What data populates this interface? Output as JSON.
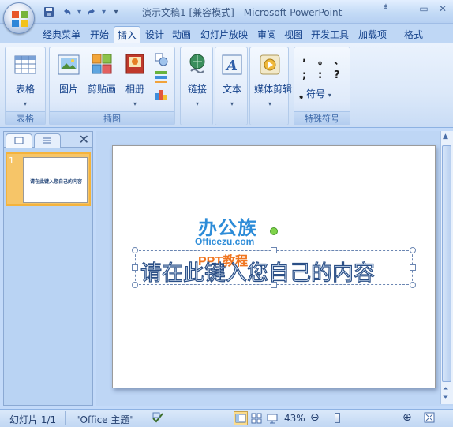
{
  "window": {
    "title": "演示文稿1 [兼容模式] - Microsoft PowerPoint"
  },
  "quick_access": {
    "items": [
      "save-icon",
      "undo-icon",
      "redo-icon",
      "customize-icon"
    ]
  },
  "tabs": [
    {
      "label": "经典菜单",
      "active": false
    },
    {
      "label": "开始",
      "active": false
    },
    {
      "label": "插入",
      "active": true
    },
    {
      "label": "设计",
      "active": false
    },
    {
      "label": "动画",
      "active": false
    },
    {
      "label": "幻灯片放映",
      "active": false
    },
    {
      "label": "审阅",
      "active": false
    },
    {
      "label": "视图",
      "active": false
    },
    {
      "label": "开发工具",
      "active": false
    },
    {
      "label": "加载项",
      "active": false
    },
    {
      "label": "格式",
      "active": false
    }
  ],
  "ribbon": {
    "table_group": {
      "label": "表格",
      "button": "表格"
    },
    "illustrations_group": {
      "label": "插图",
      "picture": "图片",
      "clipart": "剪贴画",
      "album": "相册"
    },
    "link_group": {
      "button": "链接"
    },
    "text_group": {
      "button": "文本"
    },
    "media_group": {
      "button": "媒体剪辑"
    },
    "symbols_group": {
      "label": "特殊符号",
      "button": "符号",
      "symbols": [
        ",",
        "。",
        "、",
        ";",
        ":",
        "?"
      ]
    }
  },
  "slides_panel": {
    "slide_number": "1",
    "thumb_text": "请在此键入您自己的内容"
  },
  "slide": {
    "text": "请在此键入您自己的内容",
    "watermark_main": "办公族",
    "watermark_url": "Officezu.com",
    "watermark_sub": "PPT教程"
  },
  "statusbar": {
    "slide_info": "幻灯片 1/1",
    "theme": "\"Office 主题\"",
    "zoom": "43%"
  },
  "colors": {
    "ribbon_bg": "#dbe8f9",
    "accent": "#15428b",
    "selection": "#f4b33c"
  }
}
